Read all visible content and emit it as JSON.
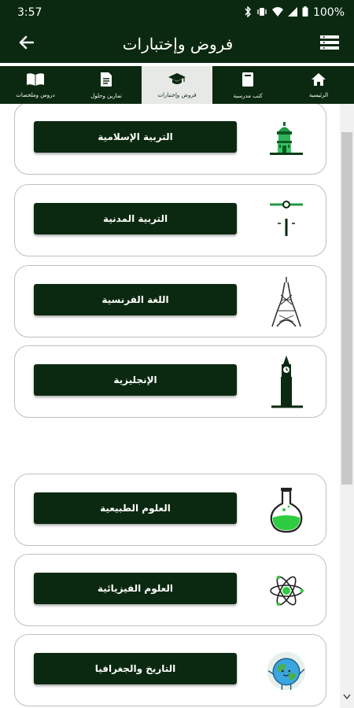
{
  "status_bar": {
    "time": "3:57",
    "battery_percent": "100%",
    "icons": [
      "bluetooth-icon",
      "vibrate-icon",
      "wifi-icon",
      "signal-icon",
      "battery-icon"
    ]
  },
  "app_bar": {
    "title": "فروض وإختبارات",
    "back_icon": "arrow-left-icon",
    "menu_icon": "list-menu-icon"
  },
  "tabs": [
    {
      "label": "الرئيسية",
      "icon": "home-icon",
      "active": false
    },
    {
      "label": "كتب مدرسية",
      "icon": "book-icon",
      "active": false
    },
    {
      "label": "فروض وإختبارات",
      "icon": "graduation-cap-icon",
      "active": true
    },
    {
      "label": "تمارين وحلول",
      "icon": "document-icon",
      "active": false
    },
    {
      "label": "دروس وملخصات",
      "icon": "open-book-icon",
      "active": false
    }
  ],
  "subjects": [
    {
      "label": "التربية الإسلامية",
      "icon": "mosque-icon"
    },
    {
      "label": "التربية المدنية",
      "icon": "scales-icon"
    },
    {
      "label": "اللغة الفرنسية",
      "icon": "eiffel-tower-icon"
    },
    {
      "label": "الإنجليزية",
      "icon": "big-ben-icon"
    },
    {
      "label": "العلوم الطبيعية",
      "icon": "flask-icon"
    },
    {
      "label": "العلوم الفيزيائية",
      "icon": "atom-icon"
    },
    {
      "label": "التاريخ والجغرافيا",
      "icon": "globe-icon"
    }
  ],
  "colors": {
    "primary": "#0b2910",
    "active_tab": "#e6e9e6",
    "card_border": "#bfbfbf",
    "flask_liquid": "#2ecc40"
  }
}
